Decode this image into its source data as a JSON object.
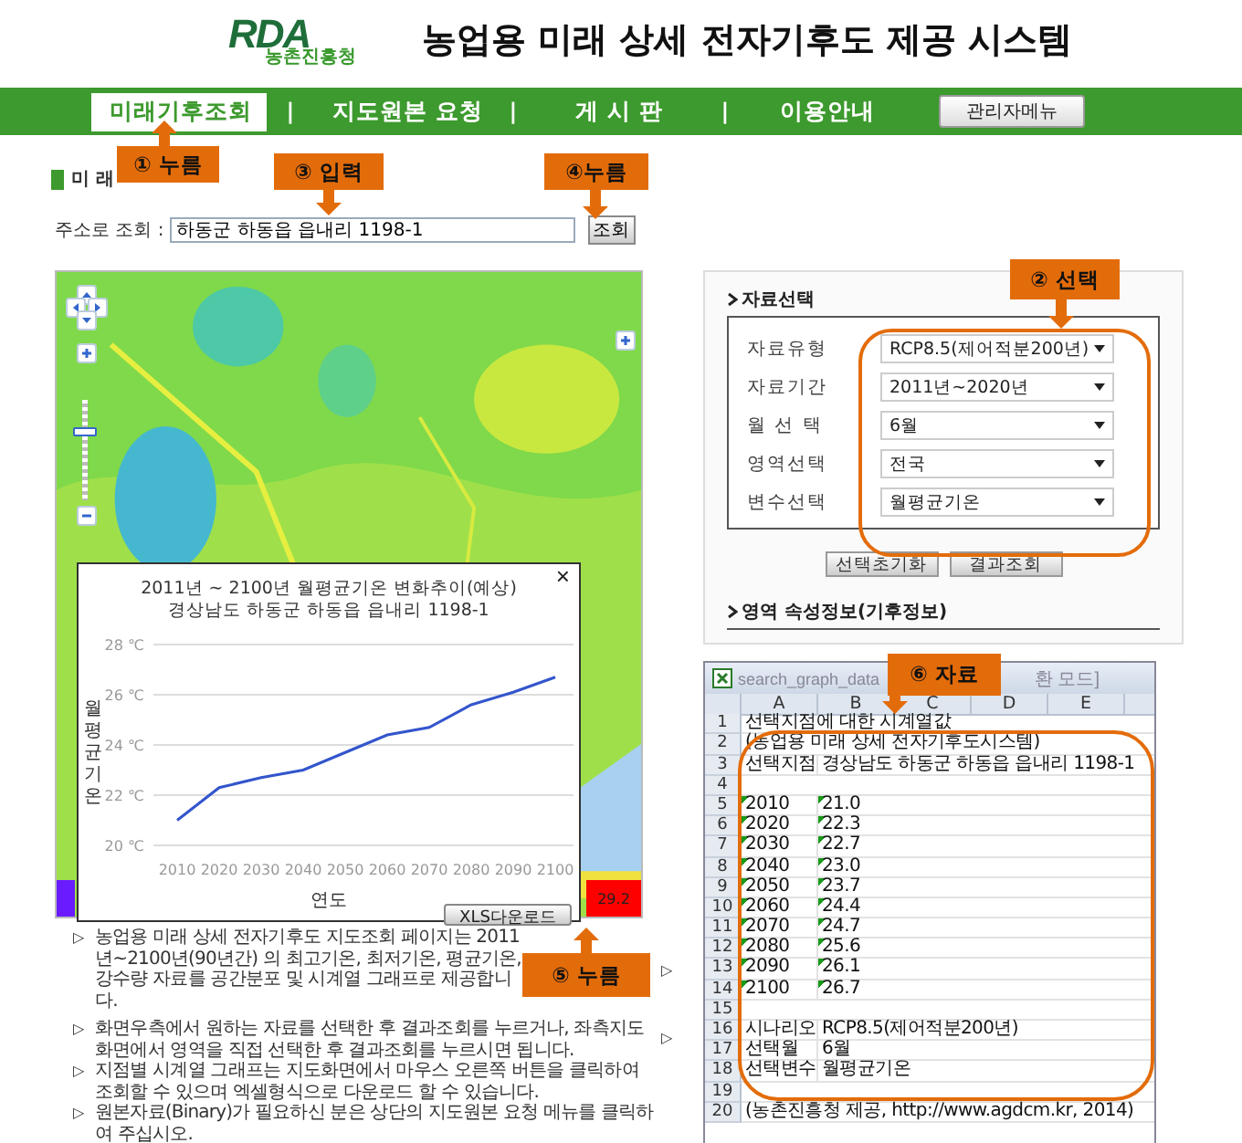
{
  "header": {
    "logo_letters": "RDA",
    "org_name": "농촌진흥청",
    "title": "농업용 미래 상세 전자기후도 제공 시스템"
  },
  "nav": {
    "items": [
      {
        "label": "미래기후조회",
        "selected": true
      },
      {
        "label": "지도원본 요청",
        "selected": false
      },
      {
        "label": "게 시 판",
        "selected": false
      },
      {
        "label": "이용안내",
        "selected": false
      }
    ],
    "separator": "|",
    "admin_button": "관리자메뉴"
  },
  "section_title": "미 래",
  "address_search": {
    "label": "주소로 조회 :",
    "value": "하동군 하동읍 읍내리 1198-1",
    "button": "조회"
  },
  "map": {
    "zoom": {
      "level": 0.7
    },
    "legend_value": "29.2"
  },
  "chart_popup": {
    "close": "×",
    "title_lines": [
      "2011년 ~ 2100년 월평균기온 변화추이(예상)",
      "경상남도 하동군 하동읍 읍내리 1198-1"
    ],
    "download_button": "XLS다운로드",
    "chart_data": {
      "type": "line",
      "xlabel": "연도",
      "ylabel": "월평균기온",
      "categories": [
        "2010",
        "2020",
        "2030",
        "2040",
        "2050",
        "2060",
        "2070",
        "2080",
        "2090",
        "2100"
      ],
      "grid": true,
      "series": [
        {
          "color": "#3355cc",
          "values": [
            21.0,
            22.3,
            22.7,
            23.0,
            23.7,
            24.4,
            24.7,
            25.6,
            26.1,
            26.7
          ]
        }
      ],
      "ylim": [
        20,
        28
      ],
      "yticks": [
        {
          "value": 20,
          "label": "20 ℃"
        },
        {
          "value": 22,
          "label": "22 ℃"
        },
        {
          "value": 24,
          "label": "24 ℃"
        },
        {
          "value": 26,
          "label": "26 ℃"
        },
        {
          "value": 28,
          "label": "28 ℃"
        }
      ]
    }
  },
  "bullets": [
    {
      "marker": "▷",
      "text": "농업용 미래 상세 전자기후도 지도조회 페이지는 2011년~2100년(90년간) 의 최고기온, 최저기온, 평균기온, 강수량 자료를 공간분포 및 시계열 그래프로 제공합니다."
    },
    {
      "marker": "▷",
      "text": "화면우측에서 원하는 자료를 선택한 후 결과조회를 누르거나, 좌측지도화면에서 영역을 직접 선택한 후 결과조회를 누르시면 됩니다."
    },
    {
      "marker": "▷",
      "text": "지점별 시계열 그래프는 지도화면에서 마우스 오른쪽 버튼을 클릭하여 조회할 수 있으며 엑셀형식으로 다운로드 할 수 있습니다."
    },
    {
      "marker": "▷",
      "text": "원본자료(Binary)가 필요하신 분은 상단의 지도원본 요청 메뉴를 클릭하여 주십시오."
    }
  ],
  "side_markers": [
    "▷",
    "▷"
  ],
  "data_panel": {
    "title": "자료선택",
    "fields": [
      {
        "label": "자료유형",
        "value": "RCP8.5(제어적분200년)"
      },
      {
        "label": "자료기간",
        "value": "2011년~2020년"
      },
      {
        "label": "월 선 택",
        "value": "6월"
      },
      {
        "label": "영역선택",
        "value": "전국"
      },
      {
        "label": "변수선택",
        "value": "월평균기온"
      }
    ],
    "buttons": [
      "선택초기화",
      "결과조회"
    ],
    "attr_title": "영역 속성정보(기후정보)"
  },
  "spreadsheet": {
    "title": "search_graph_data",
    "title_tail": "환 모드]",
    "columns": [
      "A",
      "B",
      "C",
      "D",
      "E"
    ],
    "rows": [
      {
        "num": "1",
        "kind": "plain",
        "a": "선택지점에 대한 시계열값"
      },
      {
        "num": "2",
        "kind": "plain",
        "a": "(농업용 미래 상세 전자기후도시스템)"
      },
      {
        "num": "3",
        "kind": "plain",
        "a": "선택지점",
        "b": "경상남도 하동군 하동읍 읍내리 1198-1"
      },
      {
        "num": "4",
        "kind": "plain"
      },
      {
        "num": "5",
        "kind": "text_number",
        "a": "2010",
        "b": "21.0"
      },
      {
        "num": "6",
        "kind": "text_number",
        "a": "2020",
        "b": "22.3"
      },
      {
        "num": "7",
        "kind": "text_number",
        "a": "2030",
        "b": "22.7"
      },
      {
        "num": "8",
        "kind": "text_number",
        "a": "2040",
        "b": "23.0"
      },
      {
        "num": "9",
        "kind": "text_number",
        "a": "2050",
        "b": "23.7"
      },
      {
        "num": "10",
        "kind": "text_number",
        "a": "2060",
        "b": "24.4"
      },
      {
        "num": "11",
        "kind": "text_number",
        "a": "2070",
        "b": "24.7"
      },
      {
        "num": "12",
        "kind": "text_number",
        "a": "2080",
        "b": "25.6"
      },
      {
        "num": "13",
        "kind": "text_number",
        "a": "2090",
        "b": "26.1"
      },
      {
        "num": "14",
        "kind": "text_number",
        "a": "2100",
        "b": "26.7"
      },
      {
        "num": "15",
        "kind": "plain"
      },
      {
        "num": "16",
        "kind": "plain",
        "a": "시나리오",
        "b": "RCP8.5(제어적분200년)"
      },
      {
        "num": "17",
        "kind": "plain",
        "a": "선택월",
        "b": "6월"
      },
      {
        "num": "18",
        "kind": "plain",
        "a": "선택변수",
        "b": "월평균기온"
      },
      {
        "num": "19",
        "kind": "plain"
      },
      {
        "num": "20",
        "kind": "plain",
        "a": "(농촌진흥청 제공, http://www.agdcm.kr, 2014)"
      }
    ]
  },
  "callouts": [
    {
      "text": "① 누름",
      "kind": "up"
    },
    {
      "text": "② 선택",
      "kind": "down"
    },
    {
      "text": "③ 입력",
      "kind": "down"
    },
    {
      "text": "④누름",
      "kind": "down"
    },
    {
      "text": "⑤ 누름",
      "kind": "up"
    },
    {
      "text": "⑥ 자료",
      "kind": "down"
    }
  ]
}
